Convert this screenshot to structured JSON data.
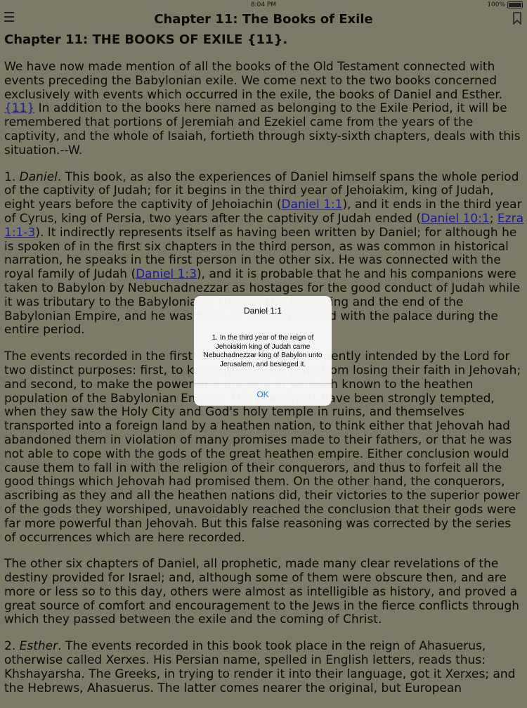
{
  "status": {
    "time": "8:04 PM",
    "battery": "100%"
  },
  "nav": {
    "title": "Chapter 11: The Books of Exile"
  },
  "content": {
    "heading": "Chapter 11: THE BOOKS OF EXILE {11}.",
    "p1_a": "We have now made mention of all the books of the Old Testament connected with events preceding the Babylonian exile. We come next to the two books concerned exclusively with events which occurred in the exile, the books of Daniel and Esther. ",
    "p1_link": "{11}",
    "p1_b": " In addition to the books here named as belonging to the Exile Period, it will be remembered that portions of Jeremiah and Ezekiel came from the years of the captivity, and the whole of Isaiah, fortieth through sixty-sixth chapters, deals with this situation.--W.",
    "p2_a": "1. ",
    "p2_em": "Daniel",
    "p2_b": ". This book, as also the experiences of Daniel himself spans the whole period of the captivity of Judah; for it begins in the third year of Jehoiakim, king of Judah, eight years before the captivity of Jehoiachin (",
    "p2_link1": "Daniel 1:1",
    "p2_c": "), and it ends in the third year of Cyrus, king of Persia, two years after the captivity of Judah ended (",
    "p2_link2": "Daniel 10:1",
    "p2_d": "; ",
    "p2_link3": "Ezra 1:1-3",
    "p2_e": "). It indirectly represents itself as having been written by Daniel; for although he is spoken of in the first six chapters in the third person, as was common in historical narration, he speaks in the first person in the other six. He was connected with the royal family of Judah (",
    "p2_link4": "Daniel 1:3",
    "p2_f": "), and it is probable that he and his companions were taken to Babylon by Nebuchadnezzar as hostages for the good conduct of Judah while it was tributary to the Babylonians. He saw the beginning and the end of the Babylonian Empire, and he was more or less connected with the palace during the entire period.",
    "p3": "The events recorded in the first six chapters were evidently intended by the Lord for two distinct purposes: first, to keep the captive Jews from losing their faith in Jehovah; and second, to make the power and majesty of Jehovah known to the heathen population of the Babylonian Empire. The Jews must have been strongly tempted, when they saw the Holy City and God's holy temple in ruins, and themselves transported into a foreign land by a heathen nation, to think either that Jehovah had abandoned them in violation of many promises made to their fathers, or that he was not able to cope with the gods of the great heathen empire. Either conclusion would cause them to fall in with the religion of their conquerors, and thus to forfeit all the good things which Jehovah had promised them. On the other hand, the conquerors, ascribing as they and all the heathen nations did, their victories to the superior power of the gods they worshiped, unavoidably reached the conclusion that their gods were far more powerful than Jehovah. But this false reasoning was corrected by the series of occurrences which are here recorded.",
    "p4": "The other six chapters of Daniel, all prophetic, made many clear revelations of the destiny provided for Israel; and, although some of them were obscure then, and are more or less so to this day, others were almost as intelligible as history, and proved a great source of comfort and encouragement to the Jews in the fierce conflicts through which they passed between the exile and the coming of Christ.",
    "p5_a": "2. ",
    "p5_em": "Esther",
    "p5_b": ". The events recorded in this book took place in the reign of Ahasuerus, otherwise called Xerxes. His Persian name, spelled in English letters, reads thus: Khshayarsha. The Greeks, in trying to render it into their language, got it Xerxes; and the Hebrews, Ahasuerus. The latter comes nearer the original, but European"
  },
  "alert": {
    "title": "Daniel 1:1",
    "message": "1. In the third year of the reign of Jehoiakim king of Judah came Nebuchadnezzar king of Babylon unto Jerusalem, and besieged it.",
    "ok": "OK"
  }
}
